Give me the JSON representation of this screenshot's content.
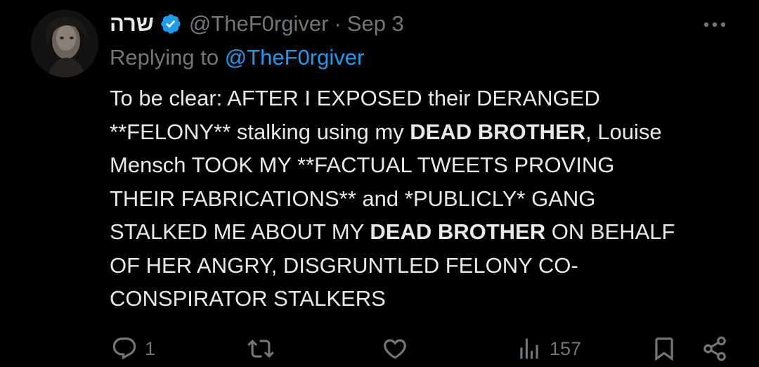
{
  "tweet": {
    "display_name": "שרה",
    "handle": "@TheF0rgiver",
    "separator": "·",
    "date": "Sep 3",
    "replying_prefix": "Replying to",
    "replying_to": "@TheF0rgiver",
    "lines": [
      {
        "segments": [
          {
            "text": "To be clear: AFTER I EXPOSED their DERANGED",
            "bold": false
          }
        ]
      },
      {
        "segments": [
          {
            "text": "**FELONY** stalking using my ",
            "bold": false
          },
          {
            "text": "DEAD BROTHER",
            "bold": true
          },
          {
            "text": ", Louise",
            "bold": false
          }
        ]
      },
      {
        "segments": [
          {
            "text": "Mensch TOOK MY **FACTUAL TWEETS PROVING",
            "bold": false
          }
        ]
      },
      {
        "segments": [
          {
            "text": "THEIR FABRICATIONS** and *PUBLICLY* GANG",
            "bold": false
          }
        ]
      },
      {
        "segments": [
          {
            "text": "STALKED ME ABOUT MY ",
            "bold": false
          },
          {
            "text": "DEAD BROTHER",
            "bold": true
          },
          {
            "text": " ON BEHALF",
            "bold": false
          }
        ]
      },
      {
        "segments": [
          {
            "text": "OF HER ANGRY, DISGRUNTLED FELONY CO-",
            "bold": false
          }
        ]
      },
      {
        "segments": [
          {
            "text": "CONSPIRATOR STALKERS",
            "bold": false
          }
        ]
      }
    ]
  },
  "actions": {
    "reply_count": "1",
    "views_count": "157"
  },
  "icons": {
    "verified": "verified-badge-icon",
    "more": "more-icon",
    "reply": "reply-icon",
    "retweet": "retweet-icon",
    "like": "like-icon",
    "views": "views-icon",
    "bookmark": "bookmark-icon",
    "share": "share-icon"
  },
  "colors": {
    "background": "#000000",
    "text": "#e7e9ea",
    "secondary": "#71767b",
    "accent": "#1d9bf0"
  }
}
